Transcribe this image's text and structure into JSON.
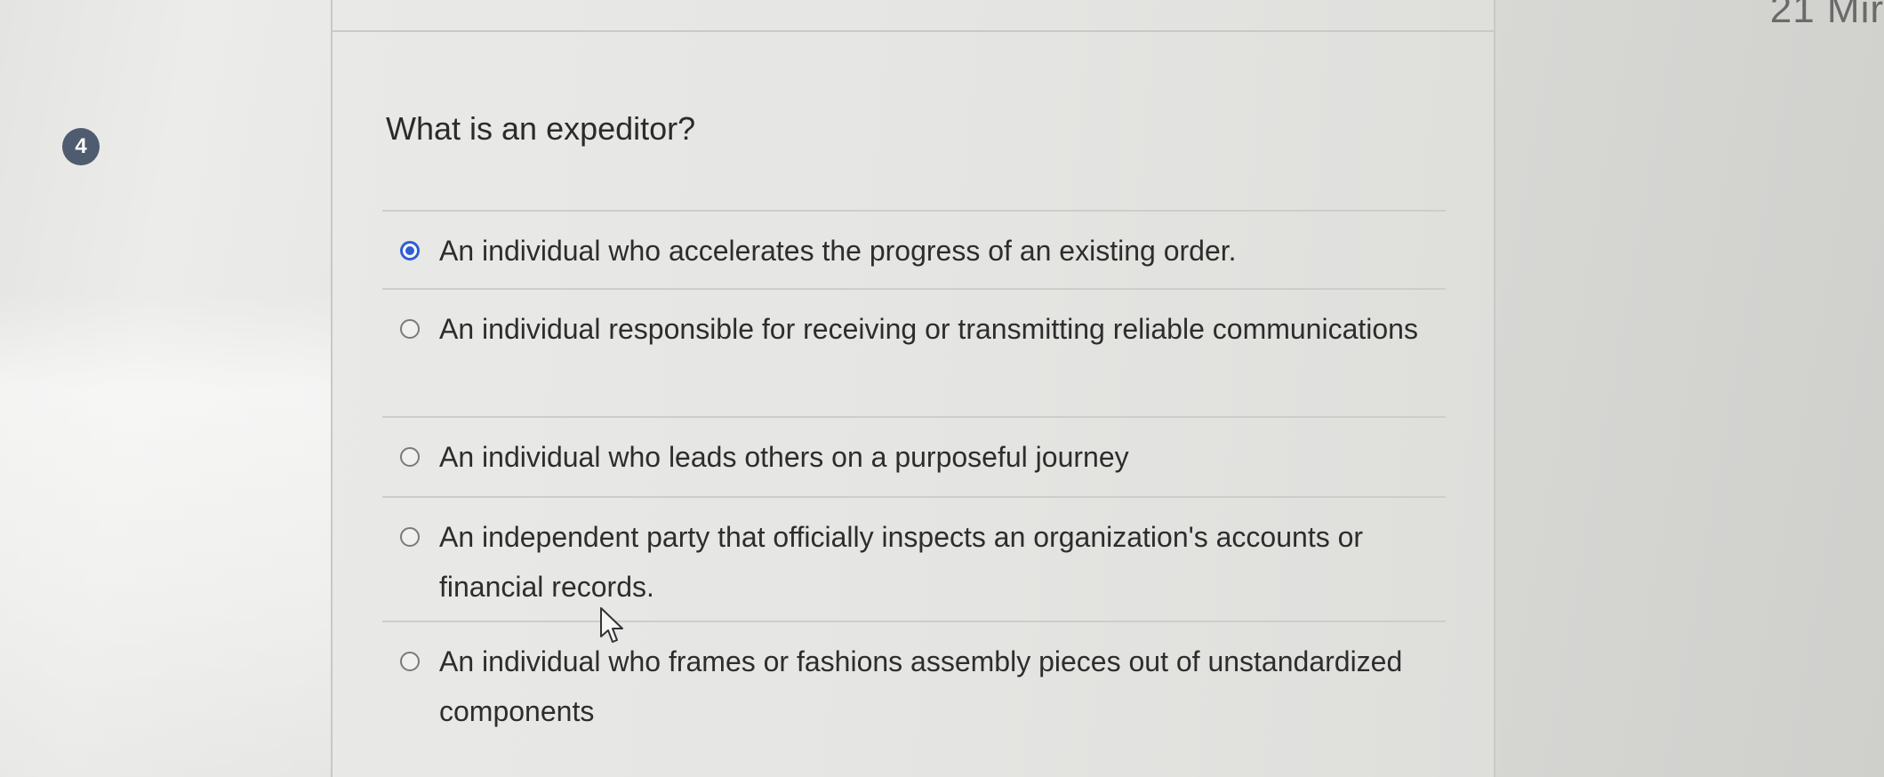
{
  "timer": {
    "text": "21 Mir"
  },
  "question": {
    "number": "4",
    "text": "What is an expeditor?"
  },
  "choices": [
    {
      "label": "An individual who accelerates the progress of an existing order.",
      "selected": true
    },
    {
      "label": "An individual responsible for receiving or transmitting  reliable communications",
      "selected": false
    },
    {
      "label": "An individual who leads others on a purposeful journey",
      "selected": false
    },
    {
      "label": "An independent party that officially inspects an organization's accounts or financial records.",
      "selected": false
    },
    {
      "label": "An individual who frames or fashions assembly pieces out of unstandardized components",
      "selected": false
    }
  ],
  "colors": {
    "accent": "#2f5fd0",
    "badge": "#4f5b6e"
  }
}
